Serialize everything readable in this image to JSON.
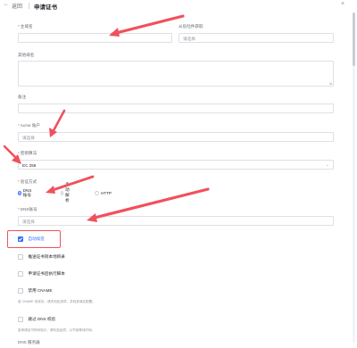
{
  "header": {
    "back_icon": "arrow-left-icon",
    "back_label": "返回",
    "title": "申请证书",
    "close_icon": "close-icon"
  },
  "form": {
    "domain": {
      "label": "主域名",
      "required": true,
      "value": ""
    },
    "fetch_from_component": {
      "label": "从危险件获取",
      "placeholder": "请选择"
    },
    "other_domains": {
      "label": "其他域名",
      "value": ""
    },
    "remarks": {
      "label": "备注",
      "value": ""
    },
    "acme_account": {
      "label": "Acme 账户",
      "required": true,
      "placeholder": "请选择"
    },
    "key_algorithm": {
      "label": "密钥算法",
      "required": true,
      "value": "EC 256"
    },
    "verify_method": {
      "label": "验证方式",
      "required": true,
      "options": [
        "DNS账号",
        "手动解析",
        "HTTP"
      ],
      "selected": "DNS账号"
    },
    "dns_account": {
      "label": "DNS账号",
      "required": true,
      "placeholder": "请选择"
    },
    "checkboxes": [
      {
        "label": "自动续签",
        "checked": true
      },
      {
        "label": "推送证书到本地目录",
        "checked": false
      },
      {
        "label": "申请证书后执行脚本",
        "checked": false
      },
      {
        "label": "禁用 CNAME",
        "checked": false
      },
      {
        "label": "跳过 DNS 校验",
        "checked": false
      }
    ],
    "cname_hint": "若 CNAME 未成功，请关闭此选项，并检查域名配置。",
    "dns_hint": "若申请证书时间较长，请勾选此项，以节省等待时间。",
    "more_label": "DNS 服务器"
  },
  "colors": {
    "primary": "#3370ff",
    "annotation": "#f0515c",
    "required": "#f54a45"
  }
}
